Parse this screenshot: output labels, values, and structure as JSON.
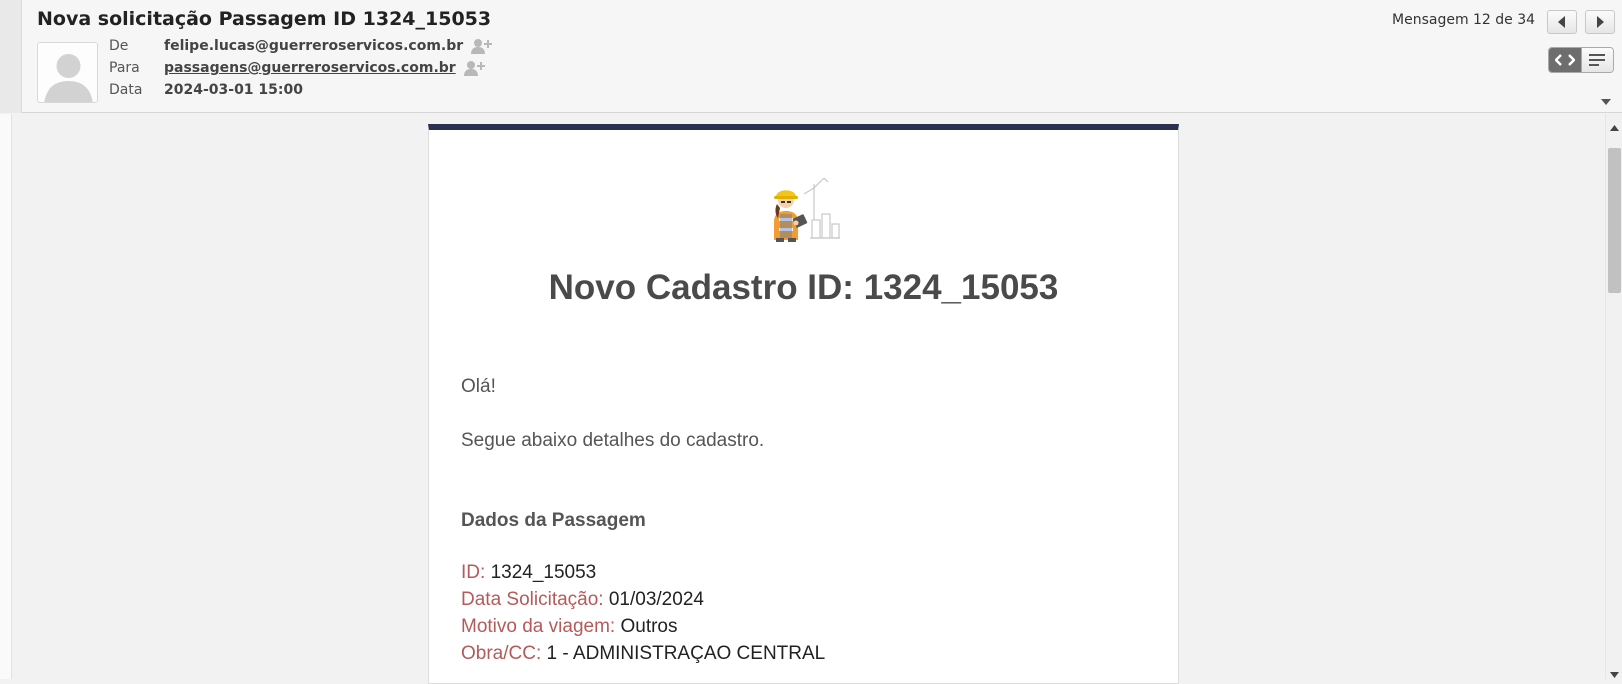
{
  "header": {
    "subject": "Nova solicitação Passagem ID 1324_15053",
    "from_label": "De",
    "from_value": "felipe.lucas@guerreroservicos.com.br",
    "to_label": "Para",
    "to_value": "passagens@guerreroservicos.com.br",
    "date_label": "Data",
    "date_value": "2024-03-01 15:00",
    "pager": "Mensagem 12 de 34"
  },
  "icons": {
    "avatar": "user-silhouette-icon",
    "add_contact": "add-contact-icon",
    "prev": "arrow-left-icon",
    "next": "arrow-right-icon",
    "html_view": "code-brackets-icon",
    "plain_view": "text-lines-icon"
  },
  "email": {
    "title": "Novo Cadastro ID: 1324_15053",
    "greeting": "Olá!",
    "intro": "Segue abaixo detalhes do cadastro.",
    "section_title": "Dados da Passagem",
    "fields": [
      {
        "label": "ID:",
        "value": "1324_15053"
      },
      {
        "label": "Data Solicitação:",
        "value": "01/03/2024"
      },
      {
        "label": "Motivo da viagem:",
        "value": "Outros"
      },
      {
        "label": "Obra/CC:",
        "value": "1 - ADMINISTRAÇAO CENTRAL"
      }
    ]
  },
  "colors": {
    "card_top_bar": "#2a3150",
    "field_label": "#b55a5a"
  }
}
